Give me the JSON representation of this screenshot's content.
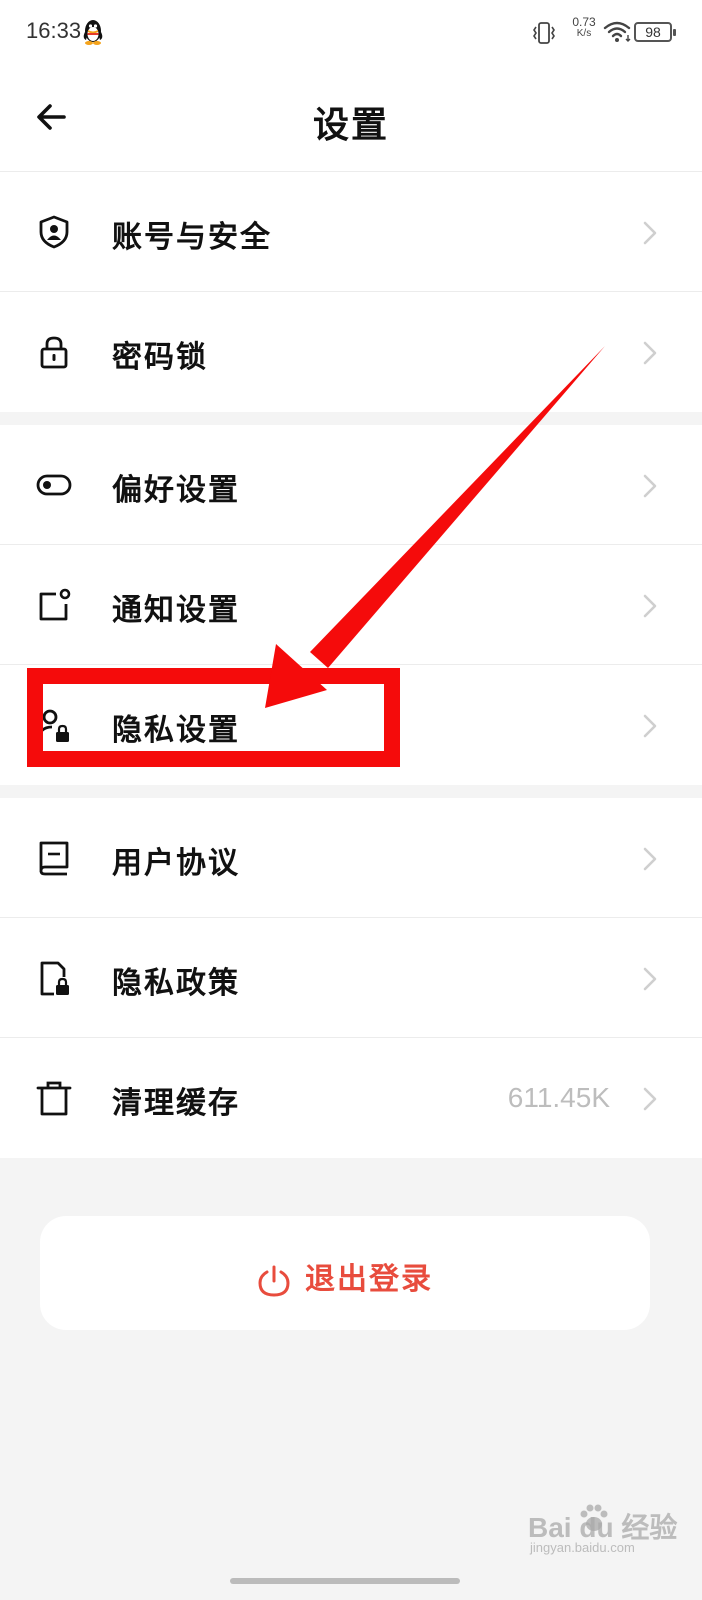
{
  "status_bar": {
    "time": "16:33",
    "net_speed_value": "0.73",
    "net_speed_unit": "K/s",
    "battery": "98",
    "icons": [
      "qq-penguin-icon",
      "vibrate-icon",
      "wifi-icon",
      "battery-icon"
    ]
  },
  "header": {
    "back_icon": "arrow-left-icon",
    "title": "设置"
  },
  "groups": [
    {
      "items": [
        {
          "icon": "shield-user-icon",
          "label": "账号与安全"
        },
        {
          "icon": "lock-icon",
          "label": "密码锁"
        }
      ]
    },
    {
      "items": [
        {
          "icon": "toggle-icon",
          "label": "偏好设置"
        },
        {
          "icon": "notification-icon",
          "label": "通知设置"
        },
        {
          "icon": "user-lock-icon",
          "label": "隐私设置"
        }
      ]
    },
    {
      "items": [
        {
          "icon": "book-icon",
          "label": "用户协议"
        },
        {
          "icon": "document-lock-icon",
          "label": "隐私政策"
        },
        {
          "icon": "trash-icon",
          "label": "清理缓存",
          "value": "611.45K"
        }
      ]
    }
  ],
  "logout": {
    "icon": "power-icon",
    "label": "退出登录"
  },
  "annotation": {
    "highlighted_item": "隐私设置",
    "color": "#f50b0b"
  },
  "watermark": {
    "logo": "Bai  du 经验",
    "sub": "jingyan.baidu.com"
  },
  "colors": {
    "accent_red": "#e84c3d",
    "background": "#f4f4f4",
    "value_gray": "#bdbdbd"
  }
}
